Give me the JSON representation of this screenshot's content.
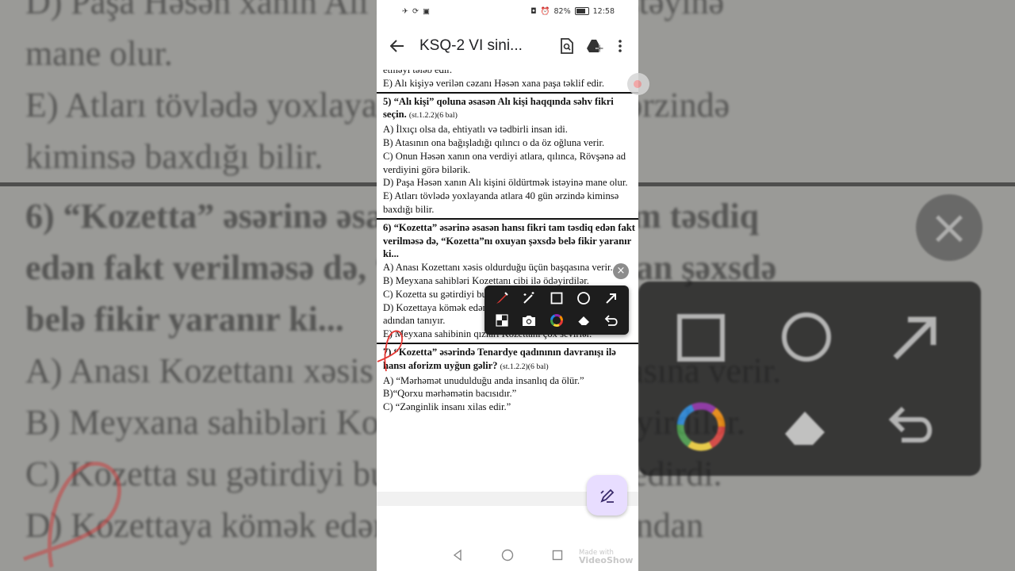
{
  "status_bar": {
    "battery": "82%",
    "time": "12:58"
  },
  "app_bar": {
    "title": "KSQ-2  VI sini..."
  },
  "document": {
    "q4_tail": "etməyi tələb edir.",
    "q4_option_e": "E) Alı kişiyə verilən cəzanı Həsən xana paşa təklif edir.",
    "q5": {
      "question": "5) “Alı kişi” qoluna əsasən Alı kişi haqqında səhv fikri seçin.",
      "tag": "(st.1.2.2)(6 bal)",
      "options": [
        "A) İlxıçı olsa da, ehtiyatlı və tədbirli insan idi.",
        "B) Atasının ona bağışladığı qılıncı o da öz oğluna verir.",
        "C) Onun Həsən xanın ona verdiyi atlara, qılınca, Rövşənə ad verdiyini görə bilərik.",
        "D) Paşa Həsən xanın Alı kişini öldürtmək istəyinə mane olur.",
        "E) Atları tövlədə yoxlayanda atlara 40 gün ərzində kiminsə baxdığı bilir."
      ]
    },
    "q6": {
      "question": "6) “Kozetta” əsərinə əsasən hansı fikri tam təsdiq edən fakt verilməsə də, “Kozetta”nı oxuyan şəxsdə belə fikir yaranır ki...",
      "options": [
        "A) Anası Kozettanı xəsis oldurduğu üçün başqasına verir.",
        "B) Meyxana sahibləri Kozettanı cibi ilə ödəyirdilər.",
        "C) Kozetta su gətirdiyi bulağa ilk dəfə idi gedirdi.",
        "D) Kozettaya kömək edən yolçu qızı simasından tanımasa da, adından tanıyır.",
        "E) Meyxana sahibinin qızları Kozettanı çox sevirlər."
      ]
    },
    "q7": {
      "question": "7) “Kozetta” əsərində Tenardye qadınının davranışı ilə hansı aforizm uyğun gəlir?",
      "tag": "(st.1.2.2)(6 bal)",
      "options": [
        "A) “Mərhəmət unudulduğu anda insanlıq da ölür.”",
        "B)“Qorxu mərhəmətin bacısıdır.”",
        "C) “Zənginlik insanı xilas edir.”"
      ]
    }
  },
  "background_text": {
    "line1": "D) Paşa Həsən xanın Alı kişini öldürtmək istəyinə",
    "line2": "mane olur.",
    "line3": "E) Atları tövlədə yoxlayanda atlara 40 gün ərzində",
    "line4": "kiminsə baxdığı bilir.",
    "line5": "6) “Kozetta” əsərinə əsasən hansı fikri tam təsdiq",
    "line6": "edən fakt verilməsə də, “Kozetta”nı oxuyan şəxsdə",
    "line7": "belə fikir yaranır ki...",
    "line8": "A) Anası Kozettanı xəsis olduğu üçün başqasına verir.",
    "line9": "B) Meyxana sahibləri Kozettanı cibi ilə ödəyirdilər.",
    "line10": "C) Kozetta su gətirdiyi bulağa ilk dəfə idi gedirdi.",
    "line11": "D) Kozettaya kömək edən yolçu qızı simasından"
  },
  "watermark": {
    "line1": "Made with",
    "line2": "VideoShow"
  },
  "colors": {
    "pen_red": "#e53935",
    "fab_bg": "#e8ddff",
    "toolbar_bg": "#1d1d1d"
  }
}
